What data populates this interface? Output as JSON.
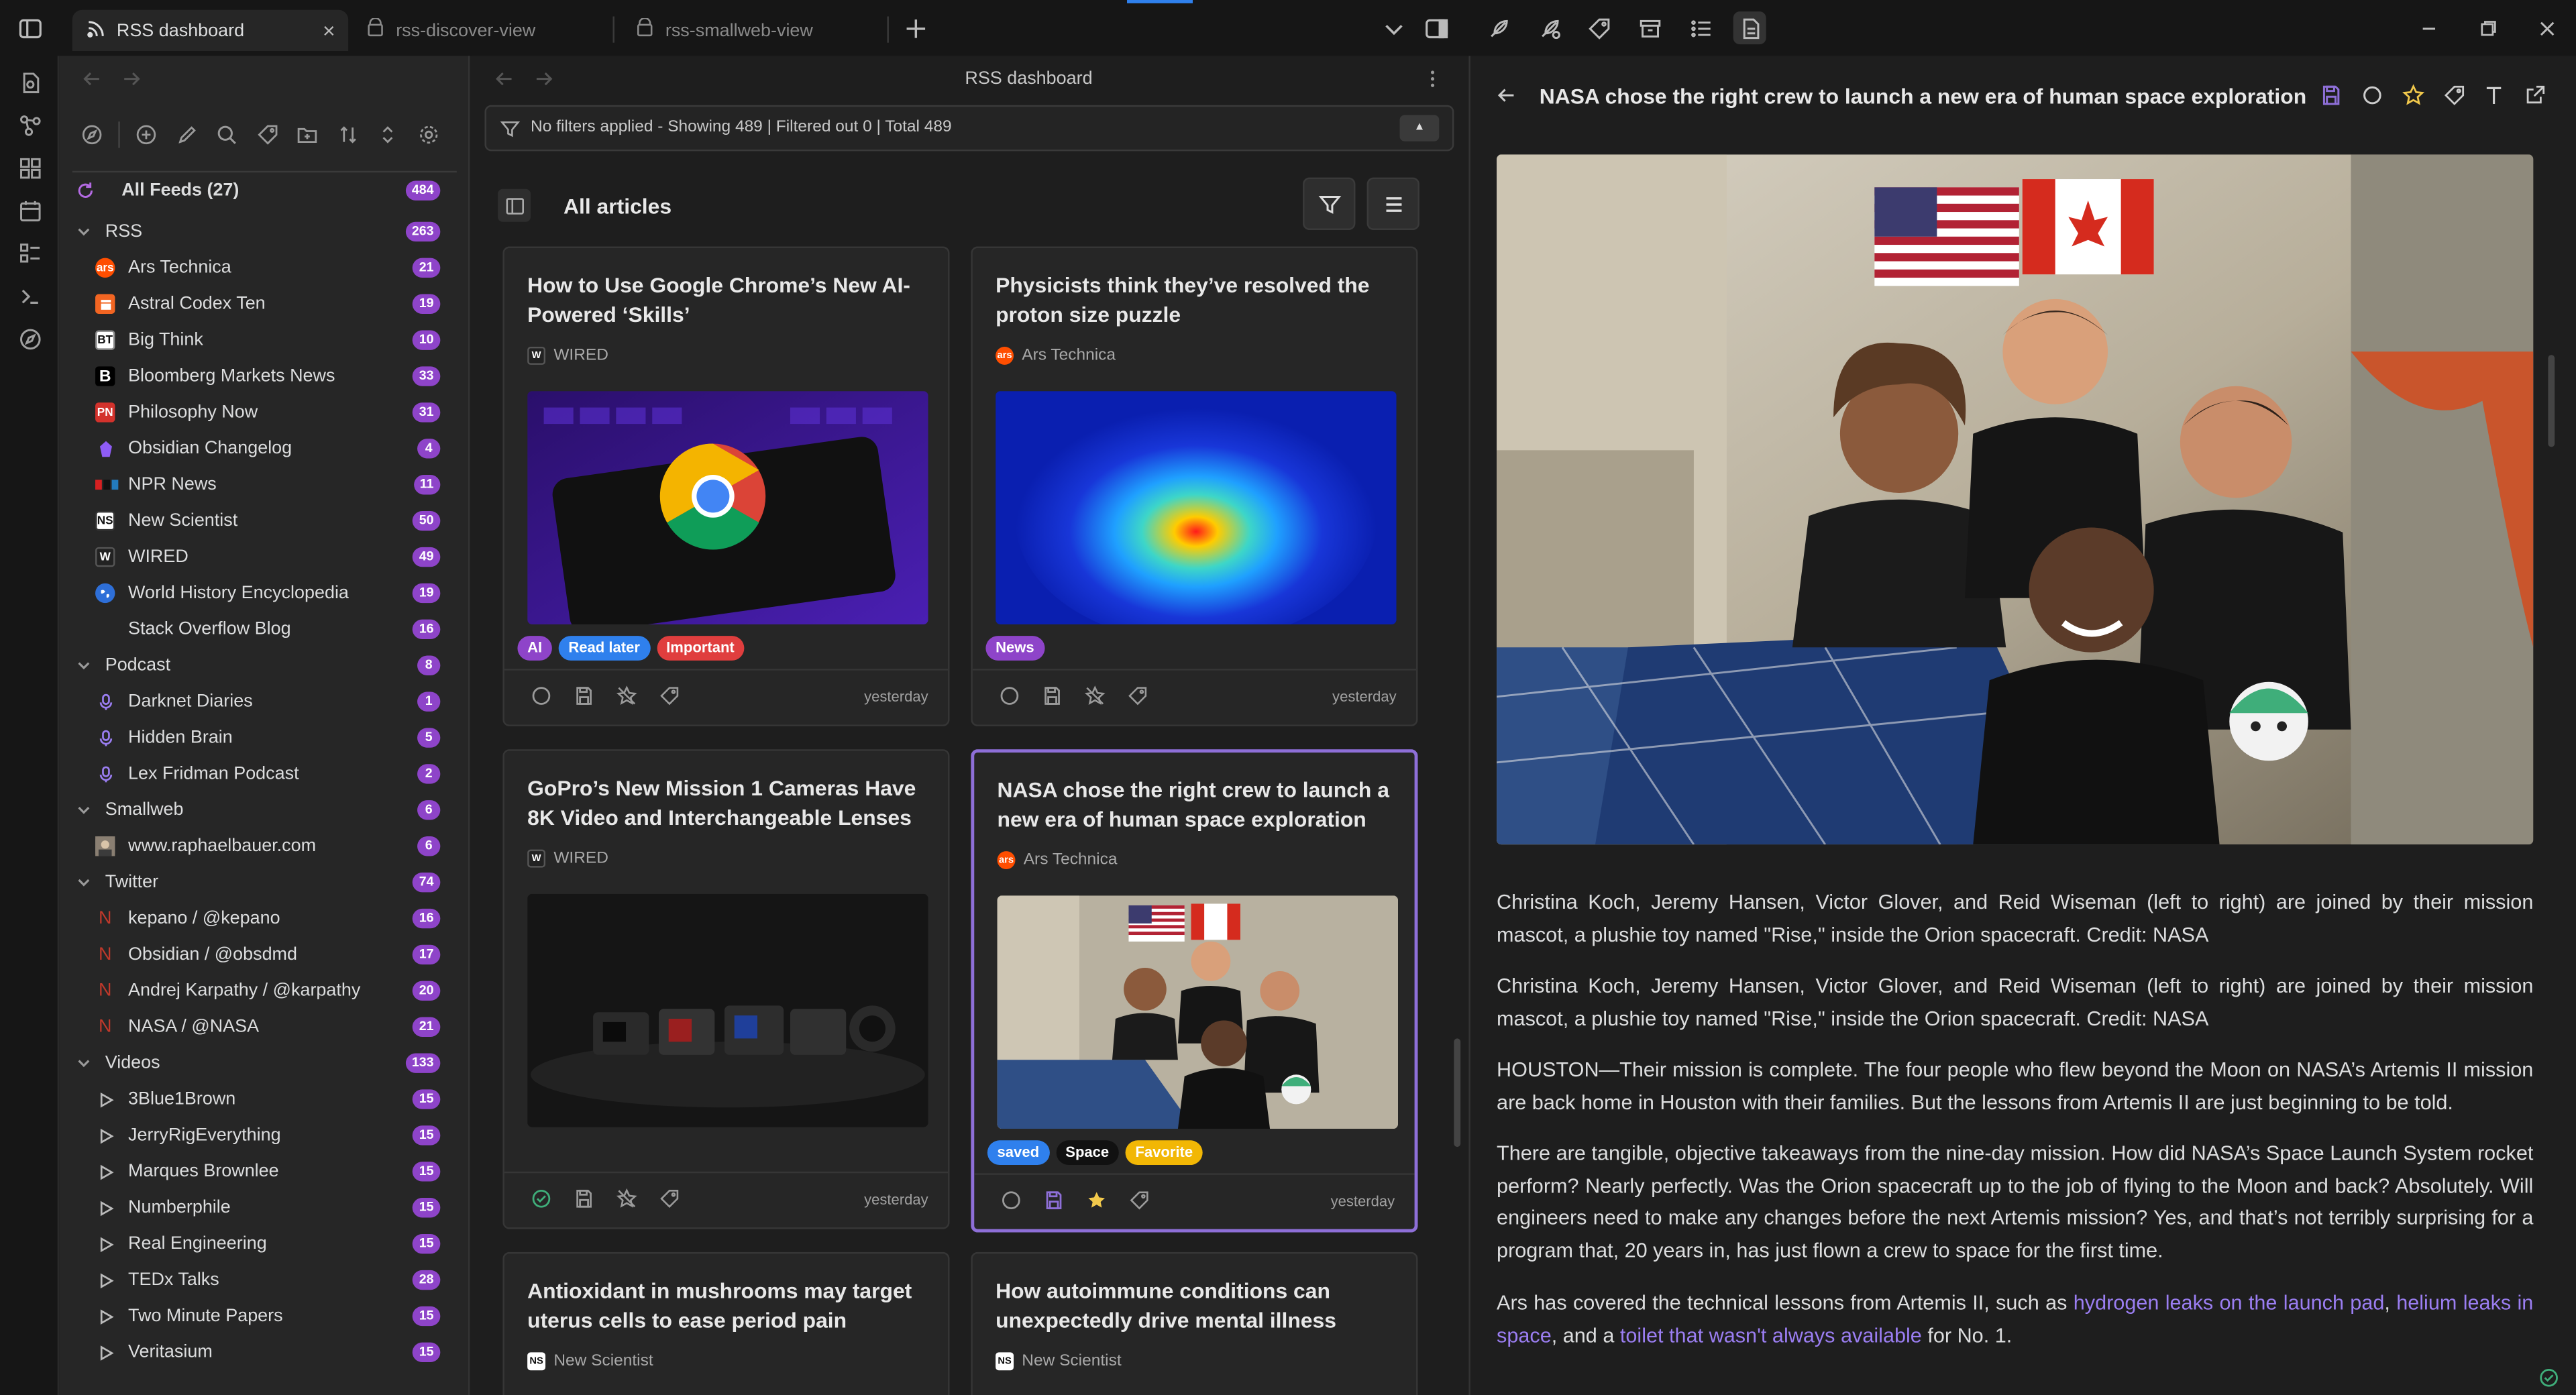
{
  "tabs": [
    {
      "label": "RSS dashboard",
      "active": true
    },
    {
      "label": "rss-discover-view",
      "active": false
    },
    {
      "label": "rss-smallweb-view",
      "active": false
    }
  ],
  "dashboard": {
    "title": "RSS dashboard",
    "filter_status": "No filters applied - Showing 489 | Filtered out 0 | Total 489",
    "view_title": "All articles"
  },
  "sidebar": {
    "all_feeds": {
      "label": "All Feeds (27)",
      "count": "484"
    },
    "folders": [
      {
        "name": "RSS",
        "count": "263",
        "feeds": [
          {
            "name": "Ars Technica",
            "count": "21",
            "icon": "ars",
            "color": "#ff4e00"
          },
          {
            "name": "Astral Codex Ten",
            "count": "19",
            "icon": "act",
            "color": "#f26522"
          },
          {
            "name": "Big Think",
            "count": "10",
            "icon": "BT",
            "color": "#ffffff"
          },
          {
            "name": "Bloomberg Markets News",
            "count": "33",
            "icon": "B",
            "color": "#000000"
          },
          {
            "name": "Philosophy Now",
            "count": "31",
            "icon": "PN",
            "color": "#d3322c"
          },
          {
            "name": "Obsidian Changelog",
            "count": "4",
            "icon": "obsidian",
            "color": "#7c3aed"
          },
          {
            "name": "NPR News",
            "count": "11",
            "icon": "npr",
            "color": "#333333"
          },
          {
            "name": "New Scientist",
            "count": "50",
            "icon": "NS",
            "color": "#ffffff"
          },
          {
            "name": "WIRED",
            "count": "49",
            "icon": "W",
            "color": "#222222"
          },
          {
            "name": "World History Encyclopedia",
            "count": "19",
            "icon": "globe",
            "color": "#2e6fd8"
          },
          {
            "name": "Stack Overflow Blog",
            "count": "16",
            "icon": "blank",
            "color": "#262626"
          }
        ]
      },
      {
        "name": "Podcast",
        "count": "8",
        "feeds": [
          {
            "name": "Darknet Diaries",
            "count": "1",
            "icon": "mic",
            "color": "#9b7ef2"
          },
          {
            "name": "Hidden Brain",
            "count": "5",
            "icon": "mic",
            "color": "#9b7ef2"
          },
          {
            "name": "Lex Fridman Podcast",
            "count": "2",
            "icon": "mic",
            "color": "#9b7ef2"
          }
        ]
      },
      {
        "name": "Smallweb",
        "count": "6",
        "feeds": [
          {
            "name": "www.raphaelbauer.com",
            "count": "6",
            "icon": "photo",
            "color": "#777777"
          }
        ]
      },
      {
        "name": "Twitter",
        "count": "74",
        "feeds": [
          {
            "name": "kepano / @kepano",
            "count": "16",
            "icon": "N",
            "color": "#c0392b"
          },
          {
            "name": "Obsidian / @obsdmd",
            "count": "17",
            "icon": "N",
            "color": "#c0392b"
          },
          {
            "name": "Andrej Karpathy / @karpathy",
            "count": "20",
            "icon": "N",
            "color": "#c0392b"
          },
          {
            "name": "NASA / @NASA",
            "count": "21",
            "icon": "N",
            "color": "#c0392b"
          }
        ]
      },
      {
        "name": "Videos",
        "count": "133",
        "feeds": [
          {
            "name": "3Blue1Brown",
            "count": "15",
            "icon": "play",
            "color": "#bbbbbb"
          },
          {
            "name": "JerryRigEverything",
            "count": "15",
            "icon": "play",
            "color": "#bbbbbb"
          },
          {
            "name": "Marques Brownlee",
            "count": "15",
            "icon": "play",
            "color": "#bbbbbb"
          },
          {
            "name": "Numberphile",
            "count": "15",
            "icon": "play",
            "color": "#bbbbbb"
          },
          {
            "name": "Real Engineering",
            "count": "15",
            "icon": "play",
            "color": "#bbbbbb"
          },
          {
            "name": "TEDx Talks",
            "count": "28",
            "icon": "play",
            "color": "#bbbbbb"
          },
          {
            "name": "Two Minute Papers",
            "count": "15",
            "icon": "play",
            "color": "#bbbbbb"
          },
          {
            "name": "Veritasium",
            "count": "15",
            "icon": "play",
            "color": "#bbbbbb"
          }
        ]
      }
    ]
  },
  "cards": [
    {
      "title": "How to Use Google Chrome’s New AI-Powered ‘Skills’",
      "source": "WIRED",
      "source_icon": "W",
      "image": "chrome-phone",
      "tags": [
        {
          "label": "AI",
          "color": "#8e44c9"
        },
        {
          "label": "Read later",
          "color": "#2f80ed"
        },
        {
          "label": "Important",
          "color": "#e03e3e"
        }
      ],
      "when": "yesterday",
      "read": false,
      "saved": false,
      "starred": false
    },
    {
      "title": "Physicists think they’ve resolved the proton size puzzle",
      "source": "Ars Technica",
      "source_icon": "ars",
      "image": "heatmap",
      "tags": [
        {
          "label": "News",
          "color": "#8e44c9"
        }
      ],
      "when": "yesterday",
      "read": false,
      "saved": false,
      "starred": false
    },
    {
      "title": "GoPro’s New Mission 1 Cameras Have 8K Video and Interchangeable Lenses",
      "source": "WIRED",
      "source_icon": "W",
      "image": "cameras",
      "tags": [],
      "when": "yesterday",
      "read": true,
      "saved": false,
      "starred": false
    },
    {
      "title": "NASA chose the right crew to launch a new era of human space exploration",
      "source": "Ars Technica",
      "source_icon": "ars",
      "image": "crew",
      "tags": [
        {
          "label": "saved",
          "color": "#2f80ed"
        },
        {
          "label": "Space",
          "color": "#111111"
        },
        {
          "label": "Favorite",
          "color": "#f2b705"
        }
      ],
      "when": "yesterday",
      "read": false,
      "saved": true,
      "starred": true,
      "selected": true
    },
    {
      "title": "Antioxidant in mushrooms may target uterus cells to ease period pain",
      "source": "New Scientist",
      "source_icon": "NS",
      "image": "",
      "tags": [],
      "when": "",
      "read": false,
      "saved": false,
      "starred": false
    },
    {
      "title": "How autoimmune conditions can unexpectedly drive mental illness",
      "source": "New Scientist",
      "source_icon": "NS",
      "image": "",
      "tags": [],
      "when": "",
      "read": false,
      "saved": false,
      "starred": false
    }
  ],
  "article": {
    "title": "NASA chose the right crew to launch a new era of human space exploration",
    "paragraphs": [
      "Christina Koch, Jeremy Hansen, Victor Glover, and Reid Wiseman (left to right) are joined by their mission mascot, a plushie toy named \"Rise,\" inside the Orion spacecraft. Credit: NASA",
      "Christina Koch, Jeremy Hansen, Victor Glover, and Reid Wiseman (left to right) are joined by their mission mascot, a plushie toy named \"Rise,\" inside the Orion spacecraft. Credit: NASA",
      "HOUSTON—Their mission is complete. The four people who flew beyond the Moon on NASA’s Artemis II mission are back home in Houston with their families. But the lessons from Artemis II are just beginning to be told.",
      "There are tangible, objective takeaways from the nine-day mission. How did NASA’s Space Launch System rocket perform? Nearly perfectly. Was the Orion spacecraft up to the job of flying to the Moon and back? Absolutely. Will engineers need to make any changes before the next Artemis mission? Yes, and that’s not terribly surprising for a program that, 20 years in, has just flown a crew to space for the first time."
    ],
    "last_paragraph": {
      "pre": "Ars has covered the technical lessons from Artemis II, such as ",
      "link1": "hydrogen leaks on the launch pad",
      "mid1": ", ",
      "link2": "helium leaks in space",
      "mid2": ", and a ",
      "link3": "toilet that wasn't always available",
      "post": " for No. 1."
    }
  },
  "colors": {
    "accent": "#8e6fd8",
    "badge": "#8e44c9",
    "link": "#9b7ef2"
  }
}
